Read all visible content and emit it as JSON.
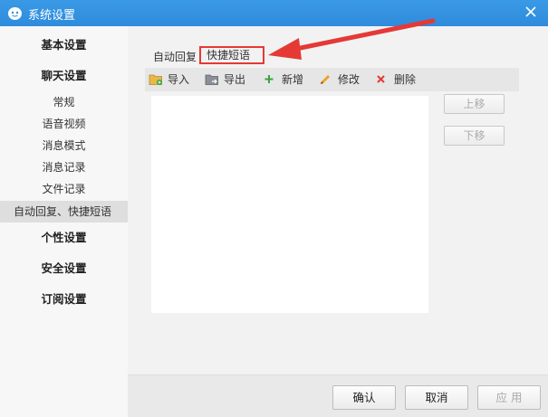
{
  "window": {
    "title": "系统设置"
  },
  "sidebar": {
    "sections": [
      {
        "label": "基本设置"
      },
      {
        "label": "聊天设置"
      },
      {
        "label": "个性设置"
      },
      {
        "label": "安全设置"
      },
      {
        "label": "订阅设置"
      }
    ],
    "chat_items": [
      {
        "label": "常规"
      },
      {
        "label": "语音视频"
      },
      {
        "label": "消息模式"
      },
      {
        "label": "消息记录"
      },
      {
        "label": "文件记录"
      },
      {
        "label": "自动回复、快捷短语",
        "active": true
      }
    ]
  },
  "tabs": [
    {
      "label": "自动回复"
    },
    {
      "label": "快捷短语",
      "active": true
    }
  ],
  "toolbar": {
    "import_label": "导入",
    "export_label": "导出",
    "add_label": "新增",
    "edit_label": "修改",
    "delete_label": "删除"
  },
  "side_buttons": {
    "move_up_label": "上移",
    "move_down_label": "下移"
  },
  "footer": {
    "ok_label": "确认",
    "cancel_label": "取消",
    "apply_label": "应 用"
  },
  "colors": {
    "titlebar": "#2f8bdc",
    "annotation": "#e53935",
    "add_icon": "#3aa53a",
    "delete_icon": "#e53935",
    "edit_icon": "#f0a020"
  },
  "icons": {
    "logo": "app-logo-icon",
    "close": "close-icon",
    "import": "folder-import-icon",
    "export": "folder-export-icon",
    "add": "plus-icon",
    "edit": "pencil-icon",
    "delete": "x-icon"
  }
}
